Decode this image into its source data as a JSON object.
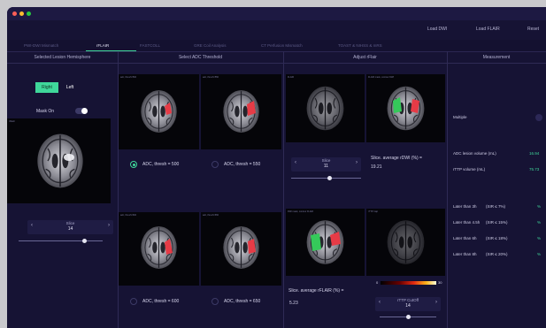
{
  "toolbar": {
    "load_dwi": "Load DWI",
    "load_flair": "Load FLAIR",
    "reset": "Reset"
  },
  "tabs": [
    {
      "label": "PWI-DWI Mismatch"
    },
    {
      "label": "rFLAIR"
    },
    {
      "label": "FASTCOLL"
    },
    {
      "label": "GRE Coil Analysis"
    },
    {
      "label": "CT Perfusion Mismatch"
    },
    {
      "label": "TOAST & NIHSS & mRS"
    }
  ],
  "colors": {
    "accent": "#3fd79a",
    "background": "#161334",
    "lesion": "#e63b46",
    "flair_lesion": "#35c95a"
  },
  "left_panel": {
    "title": "Selected Lesion Hemisphere",
    "right_label": "Right",
    "left_label": "Left",
    "mask_on_label": "Mask On",
    "mask_on": true,
    "image_label": "rFlash",
    "slice_label": "Slice",
    "slice_value": "14",
    "slider_fraction": 0.78
  },
  "adc_panel": {
    "title": "Select ADC Threshold",
    "tile_tags": [
      "adc, thresh=500",
      "adc, thresh=550",
      "adc, thresh=600",
      "adc, thresh=650"
    ],
    "options": [
      {
        "label": "ADC, thresh = 500",
        "selected": true
      },
      {
        "label": "ADC, thresh = 550",
        "selected": false
      },
      {
        "label": "ADC, thresh = 600",
        "selected": false
      },
      {
        "label": "ADC, thresh = 650",
        "selected": false
      }
    ]
  },
  "flair_panel": {
    "title": "Adjust rFlair",
    "tile_tags": [
      "FLAIR",
      "FLAIR mask, contour DWI",
      "DWI mask, contour FLAIR",
      "rTTP map"
    ],
    "slice_label": "Slice",
    "slice_value": "11",
    "dwi_avg_label": "Slice. average rDWI (%) =",
    "dwi_avg_value": "19.21",
    "flair_avg_label": "Slice. average rFLAIR (%) =",
    "flair_avg_value": "5.23",
    "colorbar_min": "0",
    "colorbar_max": "30",
    "cutoff_label": "rTTP CutOff",
    "cutoff_value": "14",
    "slider_fraction": 0.55,
    "cutoff_slider_fraction": 0.5
  },
  "measurement": {
    "title": "Measurement",
    "multiple_label": "Multiple",
    "adc_label": "ADC lesion volume (mL)",
    "adc_value": "16.94",
    "rttp_label": "rTTP volume (mL)",
    "rttp_value": "75.73",
    "later": [
      {
        "time": "Later than 3h",
        "sir": "(SIR ≤ 7%)",
        "value": "%"
      },
      {
        "time": "Later than 4.5h",
        "sir": "(SIR ≤ 15%)",
        "value": "%"
      },
      {
        "time": "Later than 6h",
        "sir": "(SIR ≤ 18%)",
        "value": "%"
      },
      {
        "time": "Later than 8h",
        "sir": "(SIR ≤ 20%)",
        "value": "%"
      }
    ]
  }
}
